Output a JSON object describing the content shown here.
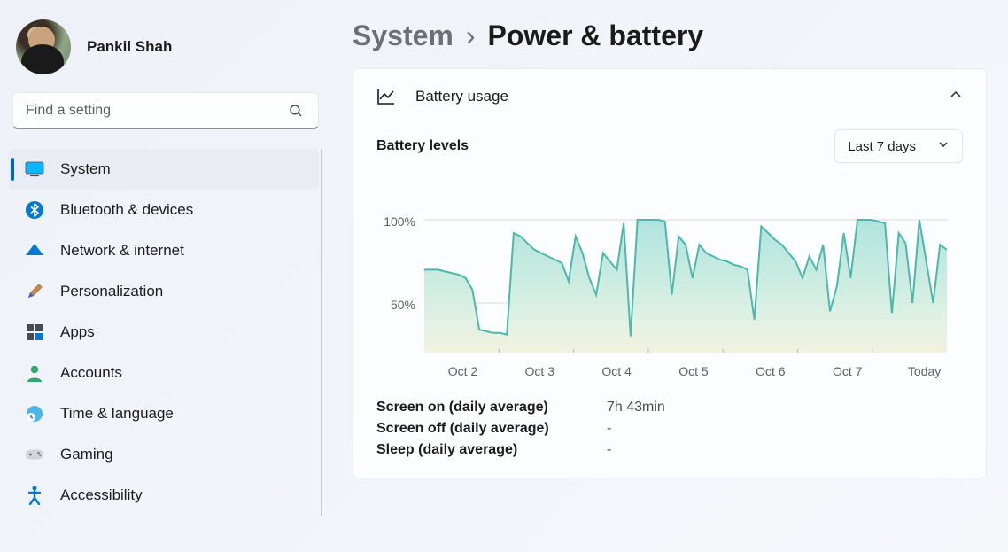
{
  "user": {
    "name": "Pankil Shah"
  },
  "search": {
    "placeholder": "Find a setting"
  },
  "sidebar": {
    "items": [
      {
        "label": "System"
      },
      {
        "label": "Bluetooth & devices"
      },
      {
        "label": "Network & internet"
      },
      {
        "label": "Personalization"
      },
      {
        "label": "Apps"
      },
      {
        "label": "Accounts"
      },
      {
        "label": "Time & language"
      },
      {
        "label": "Gaming"
      },
      {
        "label": "Accessibility"
      }
    ]
  },
  "breadcrumb": {
    "parent": "System",
    "sep": "›",
    "current": "Power & battery"
  },
  "card": {
    "title": "Battery usage",
    "levels_title": "Battery levels",
    "range_selected": "Last 7 days"
  },
  "stats": {
    "screen_on_label": "Screen on (daily average)",
    "screen_on_value": "7h 43min",
    "screen_off_label": "Screen off (daily average)",
    "screen_off_value": "-",
    "sleep_label": "Sleep (daily average)",
    "sleep_value": "-"
  },
  "chart_data": {
    "type": "area",
    "title": "Battery levels",
    "ylabel": "",
    "xlabel": "",
    "ylim": [
      0,
      100
    ],
    "y_ticks": [
      "100%",
      "50%"
    ],
    "categories": [
      "Oct 2",
      "Oct 3",
      "Oct 4",
      "Oct 5",
      "Oct 6",
      "Oct 7",
      "Today"
    ],
    "values": [
      70,
      70,
      70,
      69,
      68,
      67,
      65,
      58,
      34,
      33,
      32,
      32,
      31,
      92,
      90,
      86,
      82,
      80,
      78,
      76,
      74,
      63,
      90,
      80,
      65,
      55,
      80,
      75,
      70,
      98,
      30,
      100,
      100,
      100,
      100,
      99,
      55,
      90,
      85,
      65,
      85,
      80,
      78,
      76,
      75,
      73,
      72,
      70,
      40,
      96,
      92,
      88,
      85,
      80,
      75,
      65,
      78,
      70,
      85,
      45,
      60,
      92,
      65,
      100,
      100,
      100,
      99,
      98,
      44,
      92,
      86,
      50,
      100,
      75,
      50,
      85,
      82
    ]
  }
}
